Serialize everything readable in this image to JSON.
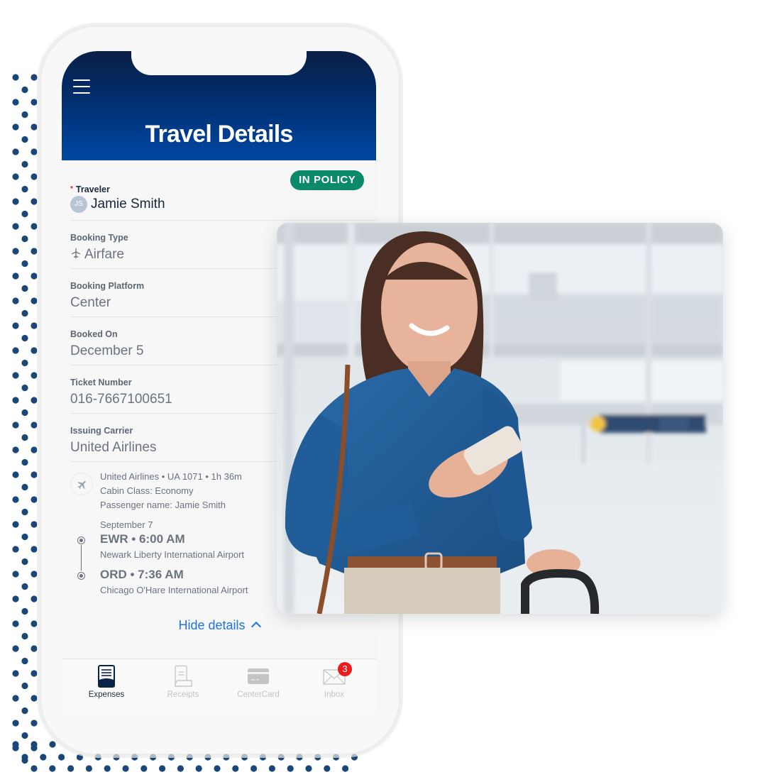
{
  "header": {
    "title": "Travel Details",
    "menu_icon": "hamburger-menu-icon"
  },
  "status_badge": "IN POLICY",
  "colors": {
    "header_top": "#0b1f45",
    "header_bottom": "#0047a3",
    "badge": "#0b8a6a",
    "link": "#1e73e8",
    "dots": "#1a4678",
    "notification": "#ea1c1c"
  },
  "traveler": {
    "label": "Traveler",
    "required_marker": "*",
    "initials": "JS",
    "name": "Jamie Smith"
  },
  "fields": [
    {
      "label": "Booking Type",
      "value": "Airfare",
      "icon": "airplane-icon"
    },
    {
      "label": "Booking Platform",
      "value": "Center"
    },
    {
      "label": "Booked On",
      "value": "December 5"
    },
    {
      "label": "Ticket Number",
      "value": "016-7667100651"
    },
    {
      "label": "Issuing Carrier",
      "value": "United Airlines"
    }
  ],
  "flight": {
    "summary": "United Airlines • UA 1071 • 1h 36m",
    "cabin": "Cabin Class: Economy",
    "passenger": "Passenger name: Jamie Smith",
    "date": "September 7",
    "departure": {
      "code_time": "EWR • 6:00 AM",
      "airport": "Newark Liberty International Airport"
    },
    "arrival": {
      "code_time": "ORD • 7:36 AM",
      "airport": "Chicago O'Hare International Airport"
    }
  },
  "hide_details_label": "Hide details",
  "tabs": [
    {
      "label": "Expenses",
      "icon": "expenses-icon",
      "active": true
    },
    {
      "label": "Receipts",
      "icon": "receipt-icon",
      "active": false
    },
    {
      "label": "CenterCard",
      "icon": "credit-card-icon",
      "active": false
    },
    {
      "label": "Inbox",
      "icon": "envelope-icon",
      "active": false,
      "badge": "3"
    }
  ],
  "photo": {
    "description": "Woman in blue blouse smiling at smartphone in airport terminal, holding luggage handle"
  }
}
